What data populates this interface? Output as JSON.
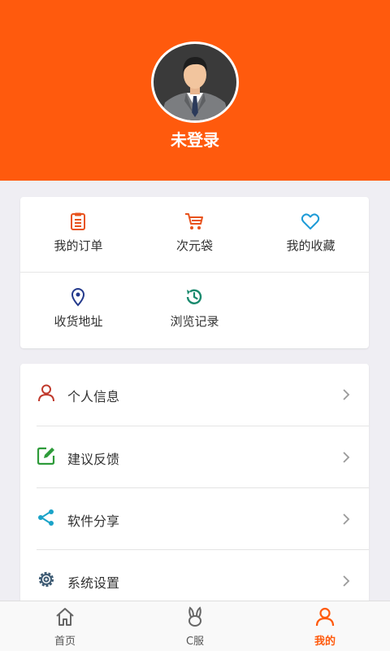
{
  "header": {
    "username": "未登录",
    "background_color": "#ff5a0d",
    "avatar_icon": "man-in-suit-avatar"
  },
  "grid": {
    "items": [
      {
        "label": "我的订单",
        "icon": "clipboard-icon",
        "color": "#e8531d"
      },
      {
        "label": "次元袋",
        "icon": "cart-icon",
        "color": "#e8531d"
      },
      {
        "label": "我的收藏",
        "icon": "heart-icon",
        "color": "#1e9bd7"
      },
      {
        "label": "收货地址",
        "icon": "location-pin-icon",
        "color": "#243a8c"
      },
      {
        "label": "浏览记录",
        "icon": "history-icon",
        "color": "#1a8a6e"
      }
    ]
  },
  "menu": {
    "items": [
      {
        "label": "个人信息",
        "icon": "person-icon",
        "color": "#c0392b"
      },
      {
        "label": "建议反馈",
        "icon": "edit-icon",
        "color": "#2e9b3a"
      },
      {
        "label": "软件分享",
        "icon": "share-icon",
        "color": "#1aa3c8"
      },
      {
        "label": "系统设置",
        "icon": "gear-icon",
        "color": "#3d5a73"
      }
    ],
    "chevron_icon": "chevron-right-icon"
  },
  "tabbar": {
    "tabs": [
      {
        "label": "首页",
        "icon": "home-icon",
        "active": false
      },
      {
        "label": "C服",
        "icon": "rabbit-icon",
        "active": false
      },
      {
        "label": "我的",
        "icon": "person-icon",
        "active": true
      }
    ],
    "active_color": "#ff5a0d"
  }
}
